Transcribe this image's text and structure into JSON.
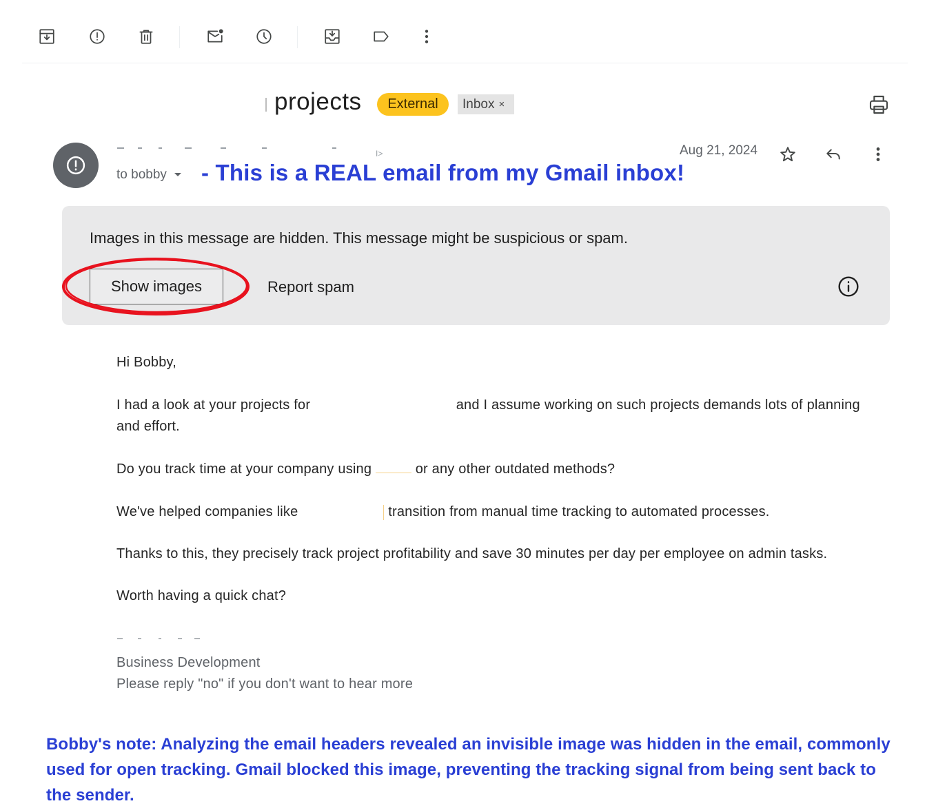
{
  "toolbar": {
    "icons": [
      "archive-icon",
      "report-spam-icon",
      "delete-icon",
      "mark-unread-icon",
      "snooze-icon",
      "move-to-icon",
      "label-icon",
      "more-vert-icon"
    ]
  },
  "subject": {
    "text": "projects",
    "badge_external": "External",
    "badge_inbox": "Inbox",
    "inbox_close": "×"
  },
  "sender": {
    "avatar_icon": "alert-icon",
    "to": "to bobby",
    "annotation": "- This is a REAL email from my Gmail inbox!",
    "date": "Aug 21, 2024"
  },
  "warning": {
    "text": "Images in this message are hidden. This message might be suspicious or spam.",
    "show_images": "Show images",
    "report_spam": "Report spam"
  },
  "body": {
    "greeting": "Hi Bobby,",
    "p1_start": "I had a look at your projects for",
    "p1_end": "and I assume working on such projects demands lots of planning",
    "p1_line2": "and effort.",
    "p2_start": "Do you track time at your company using",
    "p2_end": "or any other outdated methods?",
    "p3_start": "We've helped companies like",
    "p3_end": "transition from manual time tracking to automated processes.",
    "p4": "Thanks to this, they precisely track project profitability and save 30 minutes per day per employee on admin tasks.",
    "p5": "Worth having a quick chat?",
    "sig_title": "Business Development",
    "sig_optout": "Please reply \"no\" if you don't want to hear more"
  },
  "note": "Bobby's note: Analyzing the email headers revealed an invisible image was hidden in the email, commonly used for open tracking. Gmail blocked this image, preventing the tracking signal from being sent back to the sender.",
  "colors": {
    "annotation_blue": "#2a3fd4",
    "external_badge": "#fcc31e",
    "highlight_red": "#e8121e"
  }
}
